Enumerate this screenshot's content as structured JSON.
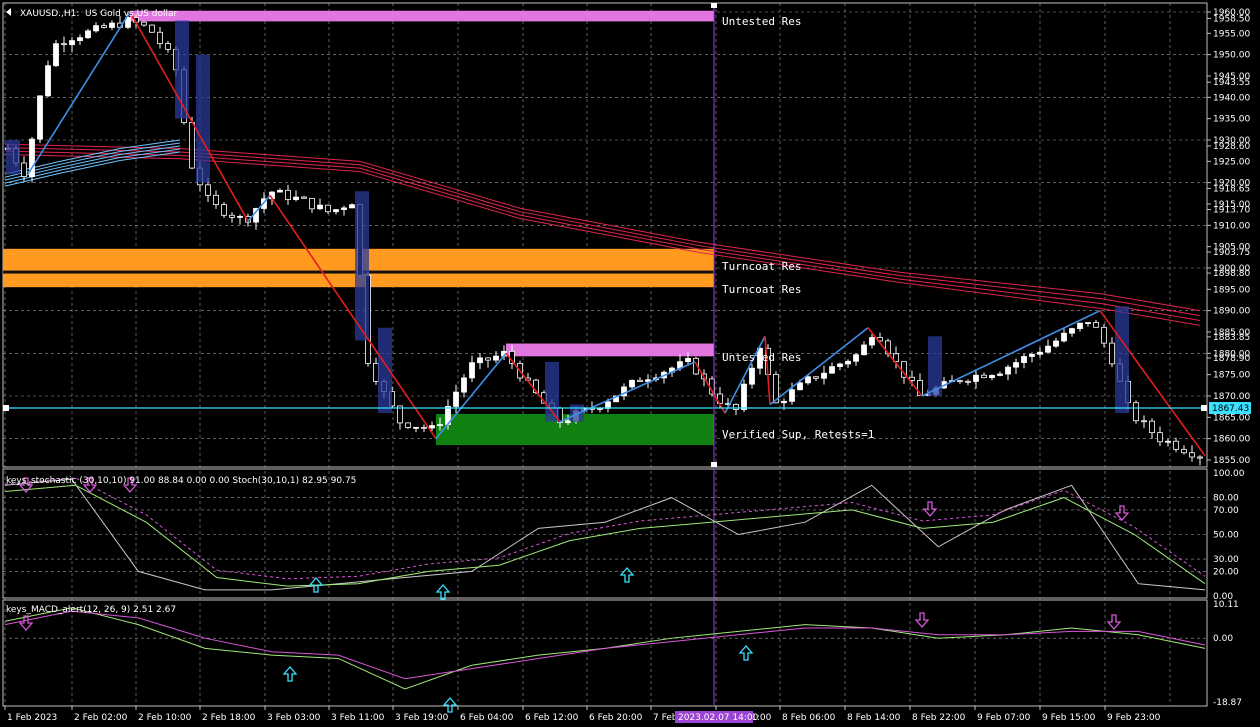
{
  "colors": {
    "background": "#000000",
    "grid": "#9a9a9a",
    "bull_candle": "#ffffff",
    "bear_candle": "#000000",
    "zigzag_up": "#3f8fe8",
    "zigzag_down": "#e51d1d",
    "ma_ribbon_blue": "#6ec3ff",
    "ma_ribbon_red": "#e0244c",
    "untested_res": "#e176e1",
    "turncoat_res": "#ff9a1f",
    "verified_sup": "#108010",
    "price_line": "#38e1ff",
    "cursor_line": "#9c44d4",
    "stoch_main": "#c8c8c8",
    "stoch_signal": "#a0e878",
    "stoch_signal2": "#d856d8",
    "macd_main": "#a0e878",
    "macd_signal": "#d856d8",
    "arrow_up": "#38e1ff",
    "arrow_down": "#d856d8"
  },
  "main": {
    "title_symbol": "XAUUSD.,H1:",
    "title_desc": "US Gold vs US dollar",
    "current_price": "1867.43",
    "y_ticks": [
      "1960.00",
      "1958.50",
      "1955.00",
      "1950.00",
      "1945.00",
      "1943.55",
      "1940.00",
      "1935.00",
      "1930.00",
      "1928.60",
      "1925.00",
      "1920.00",
      "1918.65",
      "1915.00",
      "1913.70",
      "1910.00",
      "1905.00",
      "1903.75",
      "1900.00",
      "1898.80",
      "1895.00",
      "1890.00",
      "1885.00",
      "1883.85",
      "1880.00",
      "1878.90",
      "1875.00",
      "1870.00",
      "1865.00",
      "1860.00",
      "1855.00"
    ],
    "zones": [
      {
        "label": "Untested Res"
      },
      {
        "label": "Turncoat Res"
      },
      {
        "label": "Turncoat Res"
      },
      {
        "label": "Untested Res"
      },
      {
        "label": "Verified Sup, Retests=1"
      }
    ]
  },
  "stoch": {
    "title": "keys_stochastic (30,10,10) 91.00 88.84 0.00 0.00 Stoch(30,10,1) 82.95 90.75",
    "y_ticks": [
      "100.00",
      "80.00",
      "70.00",
      "50.00",
      "30.00",
      "20.00",
      "0.00"
    ]
  },
  "macd": {
    "title": "keys_MACD_alert(12, 26, 9) 2.51 2.67",
    "y_ticks": [
      "10.11",
      "0.00",
      "-18.87"
    ]
  },
  "time_axis": {
    "labels": [
      "1 Feb 2023",
      "2 Feb 02:00",
      "2 Feb 10:00",
      "2 Feb 18:00",
      "3 Feb 03:00",
      "3 Feb 11:00",
      "3 Feb 19:00",
      "6 Feb 04:00",
      "6 Feb 12:00",
      "6 Feb 20:00",
      "7 Feb 0",
      "7 Feb 21:00",
      "8 Feb 06:00",
      "8 Feb 14:00",
      "8 Feb 22:00",
      "9 Feb 07:00",
      "9 Feb 15:00",
      "9 Feb 23:00"
    ],
    "cursor_label": "2023.02.07 14:00"
  },
  "chart_data": {
    "type": "candlestick",
    "symbol": "XAUUSD., H1",
    "ylim": [
      1855,
      1960.5
    ],
    "zones": [
      {
        "label": "Untested Res",
        "from": 1957.8,
        "to": 1960.3
      },
      {
        "label": "Turncoat Res",
        "from": 1895.5,
        "to": 1904.5
      },
      {
        "label": "Untested Res",
        "from": 1879.3,
        "to": 1882.3
      },
      {
        "label": "Verified Sup, Retests=1",
        "from": 1858.5,
        "to": 1865.8
      }
    ],
    "current_price": 1867.43,
    "candles_approx": [
      [
        1924,
        1930,
        1920,
        1928
      ],
      [
        1928,
        1935,
        1925,
        1945
      ],
      [
        1945,
        1952,
        1940,
        1955
      ],
      [
        1955,
        1956,
        1950,
        1954
      ],
      [
        1954,
        1958,
        1952,
        1956
      ],
      [
        1956,
        1960,
        1953,
        1957
      ],
      [
        1957,
        1958,
        1948,
        1950
      ],
      [
        1950,
        1952,
        1925,
        1928
      ],
      [
        1928,
        1930,
        1912,
        1915
      ],
      [
        1915,
        1918,
        1911,
        1917
      ],
      [
        1917,
        1920,
        1912,
        1913
      ],
      [
        1913,
        1916,
        1875,
        1885
      ],
      [
        1885,
        1888,
        1862,
        1866
      ],
      [
        1866,
        1870,
        1860,
        1864
      ],
      [
        1864,
        1880,
        1862,
        1878
      ],
      [
        1878,
        1884,
        1872,
        1875
      ],
      [
        1875,
        1878,
        1864,
        1868
      ],
      [
        1868,
        1872,
        1865,
        1871
      ],
      [
        1871,
        1876,
        1868,
        1874
      ],
      [
        1874,
        1878,
        1869,
        1872
      ],
      [
        1872,
        1880,
        1868,
        1878
      ],
      [
        1878,
        1886,
        1866,
        1870
      ],
      [
        1870,
        1885,
        1868,
        1882
      ],
      [
        1882,
        1886,
        1870,
        1874
      ],
      [
        1874,
        1879,
        1869,
        1872
      ],
      [
        1872,
        1890,
        1870,
        1886
      ],
      [
        1886,
        1889,
        1876,
        1878
      ],
      [
        1878,
        1882,
        1868,
        1872
      ],
      [
        1872,
        1880,
        1868,
        1879
      ],
      [
        1879,
        1891,
        1876,
        1888
      ],
      [
        1888,
        1891,
        1860,
        1862
      ],
      [
        1862,
        1866,
        1856,
        1857
      ]
    ],
    "ma_ribbon_blue_approx": [
      1922,
      1926,
      1929,
      1930,
      1929,
      1928
    ],
    "ma_ribbon_red_approx": [
      1929,
      1926,
      1915,
      1905,
      1896,
      1889
    ],
    "stoch_main_approx": [
      90,
      95,
      20,
      5,
      5,
      10,
      15,
      20,
      55,
      60,
      80,
      50,
      60,
      90,
      40,
      70,
      90,
      10,
      5
    ],
    "stoch_signal_approx": [
      85,
      90,
      60,
      15,
      8,
      10,
      20,
      25,
      45,
      55,
      60,
      65,
      70,
      55,
      60,
      80,
      50,
      10
    ],
    "macd_main_approx": [
      5,
      9,
      4,
      -3,
      -5,
      -6,
      -15,
      -8,
      -5,
      -3,
      0,
      2,
      4,
      3,
      0,
      1,
      3,
      1,
      -3
    ],
    "macd_signal_approx": [
      4,
      8,
      6,
      0,
      -4,
      -5,
      -12,
      -9,
      -6,
      -3,
      -1,
      1,
      3,
      3,
      1,
      1,
      2,
      2,
      -2
    ]
  }
}
